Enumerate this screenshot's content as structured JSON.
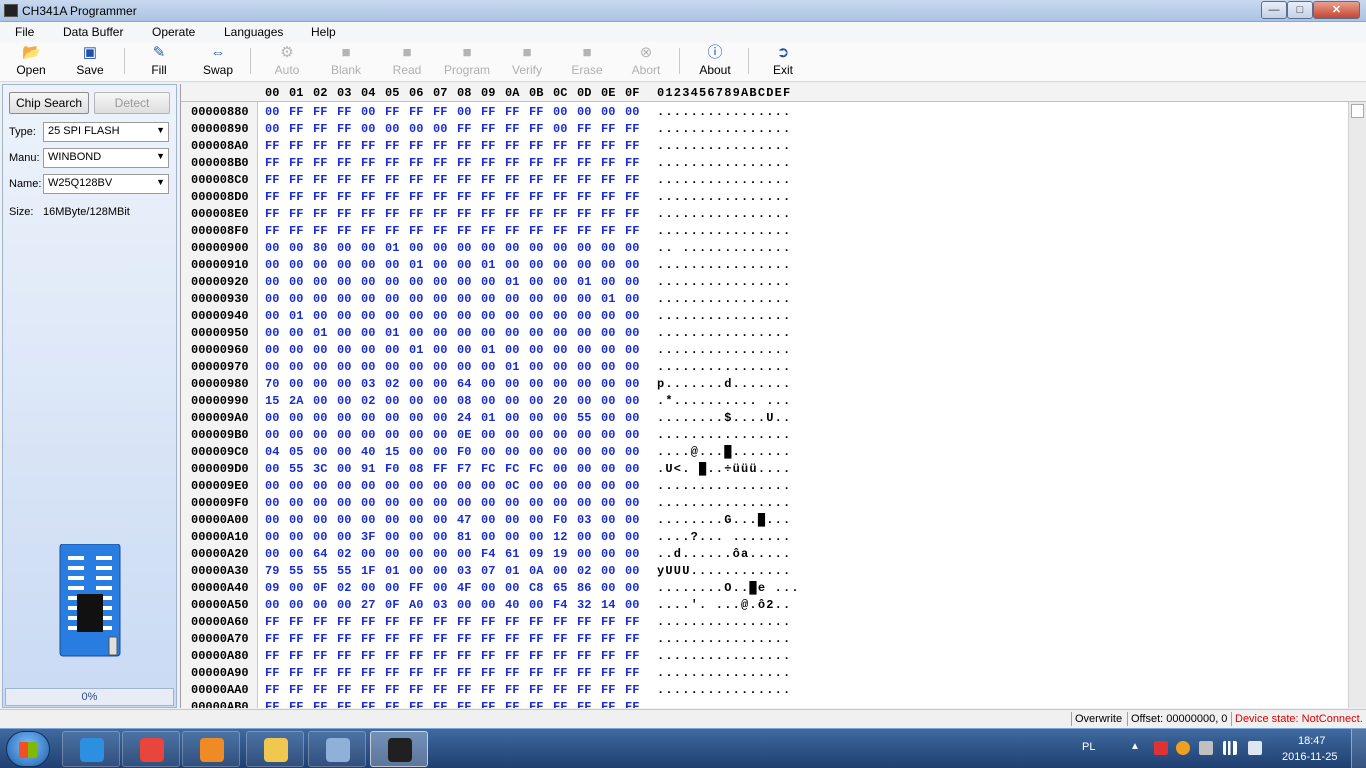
{
  "window": {
    "title": "CH341A Programmer",
    "minimize": "—",
    "maximize": "□",
    "close": "✕"
  },
  "menu": [
    "File",
    "Data Buffer",
    "Operate",
    "Languages",
    "Help"
  ],
  "toolbar": [
    {
      "label": "Open",
      "icon": "open-folder-icon",
      "enabled": true
    },
    {
      "label": "Save",
      "icon": "save-disk-icon",
      "enabled": true
    },
    {
      "label": "Fill",
      "icon": "fill-icon",
      "enabled": true
    },
    {
      "label": "Swap",
      "icon": "swap-arrows-icon",
      "enabled": true
    },
    {
      "label": "Auto",
      "icon": "auto-gear-icon",
      "enabled": false
    },
    {
      "label": "Blank",
      "icon": "blank-chip-icon",
      "enabled": false
    },
    {
      "label": "Read",
      "icon": "read-chip-icon",
      "enabled": false
    },
    {
      "label": "Program",
      "icon": "program-chip-icon",
      "enabled": false
    },
    {
      "label": "Verify",
      "icon": "verify-chip-icon",
      "enabled": false
    },
    {
      "label": "Erase",
      "icon": "erase-chip-icon",
      "enabled": false
    },
    {
      "label": "Abort",
      "icon": "abort-icon",
      "enabled": false
    },
    {
      "label": "About",
      "icon": "info-icon",
      "enabled": true
    },
    {
      "label": "Exit",
      "icon": "exit-door-icon",
      "enabled": true
    }
  ],
  "left_panel": {
    "chip_search": "Chip Search",
    "detect": "Detect",
    "type_label": "Type:",
    "type_value": "25 SPI FLASH",
    "manu_label": "Manu:",
    "manu_value": "WINBOND",
    "name_label": "Name:",
    "name_value": "W25Q128BV",
    "size_label": "Size:",
    "size_value": "16MByte/128MBit",
    "progress": 0,
    "progress_text": "0%"
  },
  "hex": {
    "columns": [
      "00",
      "01",
      "02",
      "03",
      "04",
      "05",
      "06",
      "07",
      "08",
      "09",
      "0A",
      "0B",
      "0C",
      "0D",
      "0E",
      "0F"
    ],
    "ascii_header": "0123456789ABCDEF",
    "rows": [
      {
        "addr": "00000880",
        "bytes": "00 FF FF FF 00 FF FF FF 00 FF FF FF 00 00 00 00",
        "ascii": "................"
      },
      {
        "addr": "00000890",
        "bytes": "00 FF FF FF 00 00 00 00 FF FF FF FF 00 FF FF FF",
        "ascii": "................"
      },
      {
        "addr": "000008A0",
        "bytes": "FF FF FF FF FF FF FF FF FF FF FF FF FF FF FF FF",
        "ascii": "................"
      },
      {
        "addr": "000008B0",
        "bytes": "FF FF FF FF FF FF FF FF FF FF FF FF FF FF FF FF",
        "ascii": "................"
      },
      {
        "addr": "000008C0",
        "bytes": "FF FF FF FF FF FF FF FF FF FF FF FF FF FF FF FF",
        "ascii": "................"
      },
      {
        "addr": "000008D0",
        "bytes": "FF FF FF FF FF FF FF FF FF FF FF FF FF FF FF FF",
        "ascii": "................"
      },
      {
        "addr": "000008E0",
        "bytes": "FF FF FF FF FF FF FF FF FF FF FF FF FF FF FF FF",
        "ascii": "................"
      },
      {
        "addr": "000008F0",
        "bytes": "FF FF FF FF FF FF FF FF FF FF FF FF FF FF FF FF",
        "ascii": "................"
      },
      {
        "addr": "00000900",
        "bytes": "00 00 80 00 00 01 00 00 00 00 00 00 00 00 00 00",
        "ascii": ".. ............."
      },
      {
        "addr": "00000910",
        "bytes": "00 00 00 00 00 00 01 00 00 01 00 00 00 00 00 00",
        "ascii": "................"
      },
      {
        "addr": "00000920",
        "bytes": "00 00 00 00 00 00 00 00 00 00 01 00 00 01 00 00",
        "ascii": "................"
      },
      {
        "addr": "00000930",
        "bytes": "00 00 00 00 00 00 00 00 00 00 00 00 00 00 01 00",
        "ascii": "................"
      },
      {
        "addr": "00000940",
        "bytes": "00 01 00 00 00 00 00 00 00 00 00 00 00 00 00 00",
        "ascii": "................"
      },
      {
        "addr": "00000950",
        "bytes": "00 00 01 00 00 01 00 00 00 00 00 00 00 00 00 00",
        "ascii": "................"
      },
      {
        "addr": "00000960",
        "bytes": "00 00 00 00 00 00 01 00 00 01 00 00 00 00 00 00",
        "ascii": "................"
      },
      {
        "addr": "00000970",
        "bytes": "00 00 00 00 00 00 00 00 00 00 01 00 00 00 00 00",
        "ascii": "................"
      },
      {
        "addr": "00000980",
        "bytes": "70 00 00 00 03 02 00 00 64 00 00 00 00 00 00 00",
        "ascii": "p.......d......."
      },
      {
        "addr": "00000990",
        "bytes": "15 2A 00 00 02 00 00 00 08 00 00 00 20 00 00 00",
        "ascii": ".*.......... ..."
      },
      {
        "addr": "000009A0",
        "bytes": "00 00 00 00 00 00 00 00 24 01 00 00 00 55 00 00",
        "ascii": "........$....U.."
      },
      {
        "addr": "000009B0",
        "bytes": "00 00 00 00 00 00 00 00 0E 00 00 00 00 00 00 00",
        "ascii": "................"
      },
      {
        "addr": "000009C0",
        "bytes": "04 05 00 00 40 15 00 00 F0 00 00 00 00 00 00 00",
        "ascii": "....@...█......."
      },
      {
        "addr": "000009D0",
        "bytes": "00 55 3C 00 91 F0 08 FF F7 FC FC FC 00 00 00 00",
        "ascii": ".U<. █..÷üüü...."
      },
      {
        "addr": "000009E0",
        "bytes": "00 00 00 00 00 00 00 00 00 00 0C 00 00 00 00 00",
        "ascii": "................"
      },
      {
        "addr": "000009F0",
        "bytes": "00 00 00 00 00 00 00 00 00 00 00 00 00 00 00 00",
        "ascii": "................"
      },
      {
        "addr": "00000A00",
        "bytes": "00 00 00 00 00 00 00 00 47 00 00 00 F0 03 00 00",
        "ascii": "........G...█..."
      },
      {
        "addr": "00000A10",
        "bytes": "00 00 00 00 3F 00 00 00 81 00 00 00 12 00 00 00",
        "ascii": "....?... ......."
      },
      {
        "addr": "00000A20",
        "bytes": "00 00 64 02 00 00 00 00 00 F4 61 09 19 00 00 00",
        "ascii": "..d......ôa....."
      },
      {
        "addr": "00000A30",
        "bytes": "79 55 55 55 1F 01 00 00 03 07 01 0A 00 02 00 00",
        "ascii": "yUUU............"
      },
      {
        "addr": "00000A40",
        "bytes": "09 00 0F 02 00 00 FF 00 4F 00 00 C8 65 86 00 00",
        "ascii": "........O..█e ..."
      },
      {
        "addr": "00000A50",
        "bytes": "00 00 00 00 27 0F A0 03 00 00 40 00 F4 32 14 00",
        "ascii": "....'. ...@.ô2.."
      },
      {
        "addr": "00000A60",
        "bytes": "FF FF FF FF FF FF FF FF FF FF FF FF FF FF FF FF",
        "ascii": "................"
      },
      {
        "addr": "00000A70",
        "bytes": "FF FF FF FF FF FF FF FF FF FF FF FF FF FF FF FF",
        "ascii": "................"
      },
      {
        "addr": "00000A80",
        "bytes": "FF FF FF FF FF FF FF FF FF FF FF FF FF FF FF FF",
        "ascii": "................"
      },
      {
        "addr": "00000A90",
        "bytes": "FF FF FF FF FF FF FF FF FF FF FF FF FF FF FF FF",
        "ascii": "................"
      },
      {
        "addr": "00000AA0",
        "bytes": "FF FF FF FF FF FF FF FF FF FF FF FF FF FF FF FF",
        "ascii": "................"
      },
      {
        "addr": "00000AB0",
        "bytes": "FF FF FF FF FF FF FF FF FF FF FF FF FF FF FF FF",
        "ascii": "................"
      }
    ]
  },
  "status": {
    "mode": "Overwrite",
    "offset": "Offset: 00000000, 0",
    "device": "Device state: NotConnect.",
    "device_color": "#e00000"
  },
  "taskbar": {
    "items": [
      {
        "name": "internet-explorer-icon",
        "color": "#2d8fe0",
        "active": false
      },
      {
        "name": "chrome-icon",
        "color": "#e8453c",
        "active": false
      },
      {
        "name": "media-player-icon",
        "color": "#f08a24",
        "active": false
      },
      {
        "name": "file-explorer-icon",
        "color": "#f0c850",
        "active": false
      },
      {
        "name": "remote-desktop-icon",
        "color": "#8fb0d8",
        "active": false
      },
      {
        "name": "ch341a-programmer-icon",
        "color": "#202020",
        "active": true
      }
    ],
    "language": "PL",
    "time": "18:47",
    "date": "2016-11-25"
  }
}
